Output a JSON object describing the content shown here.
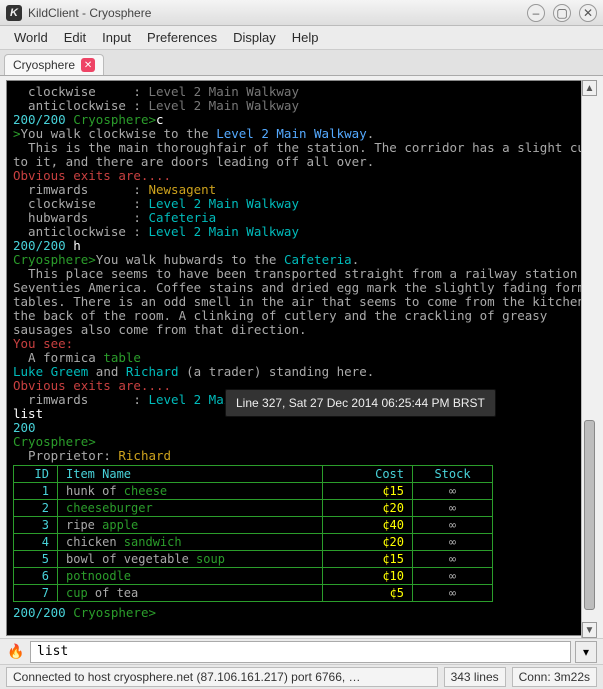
{
  "window": {
    "title": "KildClient - Cryosphere"
  },
  "menu": {
    "items": [
      "World",
      "Edit",
      "Input",
      "Preferences",
      "Display",
      "Help"
    ]
  },
  "tabs": [
    {
      "label": "Cryosphere"
    }
  ],
  "tooltip": "Line 327, Sat 27 Dec 2014 06:25:44 PM BRST",
  "hp": "200/200",
  "world_prompt": "Cryosphere>",
  "input": {
    "value": "list"
  },
  "status": {
    "connection": "Connected to host cryosphere.net (87.106.161.217) port 6766, …",
    "lines": "343 lines",
    "timer": "Conn: 3m22s"
  },
  "log": {
    "line1a": "  clockwise     : ",
    "line1b": "Level 2 Main Walkway",
    "line2a": "  anticlockwise : ",
    "line2b": "Level 2 Main Walkway",
    "mc_text": "You walk clockwise to the ",
    "mc_dest": "Level 2 Main Walkway",
    "desc1": "  This is the main thoroughfair of the station. The corridor has a slight curve",
    "desc2": "to it, and there are doors leading off all over.",
    "exits_hdr": "Obvious exits are....",
    "ex1a": "  rimwards      : ",
    "ex1b": "Newsagent",
    "ex2a": "  clockwise     : ",
    "ex2b": "Level 2 Main Walkway",
    "ex3a": "  hubwards      : ",
    "ex3b": "Cafeteria",
    "ex4a": "  anticlockwise : ",
    "ex4b": "Level 2 Main Walkway",
    "after_prompt": "h",
    "mh_text": "You walk hubwards to the ",
    "mh_dest": "Cafeteria",
    "cafe1": "  This place seems to have been transported straight from a railway station in",
    "cafe2": "Seventies America. Coffee stains and dried egg mark the slightly fading formica",
    "cafe3": "tables. There is an odd smell in the air that seems to come from the kitchen at",
    "cafe4": "the back of the room. A clinking of cutlery and the crackling of greasy",
    "cafe5": "sausages also come from that direction.",
    "yousee": "You see:",
    "formica_a": "  A formica ",
    "formica_b": "table",
    "people_a": "Luke Greem",
    "people_b": " and ",
    "people_c": "Richard",
    "people_d": " (a trader) standing here.",
    "ex_rim": "Level 2 Main ",
    "after_list": "list",
    "prop_a": "  Proprietor",
    "prop_b": ": ",
    "prop_c": "Richard"
  },
  "table": {
    "headers": {
      "id": "ID",
      "name": "Item Name",
      "cost": "Cost",
      "stock": "Stock"
    },
    "rows": [
      {
        "id": "1",
        "t1": "hunk of ",
        "hi": "cheese",
        "t2": "",
        "cost": "¢15",
        "stock": "∞"
      },
      {
        "id": "2",
        "t1": "",
        "hi": "cheeseburger",
        "t2": "",
        "cost": "¢20",
        "stock": "∞"
      },
      {
        "id": "3",
        "t1": "ripe ",
        "hi": "apple",
        "t2": "",
        "cost": "¢40",
        "stock": "∞"
      },
      {
        "id": "4",
        "t1": "chicken ",
        "hi": "sandwich",
        "t2": "",
        "cost": "¢20",
        "stock": "∞"
      },
      {
        "id": "5",
        "t1": "bowl of vegetable ",
        "hi": "soup",
        "t2": "",
        "cost": "¢15",
        "stock": "∞"
      },
      {
        "id": "6",
        "t1": "",
        "hi": "potnoodle",
        "t2": "",
        "cost": "¢10",
        "stock": "∞"
      },
      {
        "id": "7",
        "t1": "",
        "hi": "cup",
        "t2": " of tea",
        "cost": "¢5",
        "stock": "∞"
      }
    ]
  }
}
